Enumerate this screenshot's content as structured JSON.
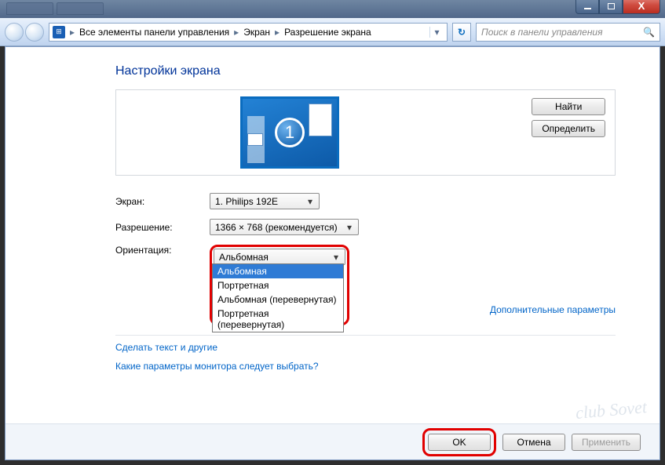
{
  "window": {
    "minimize": "_",
    "maximize": "□",
    "close": "X"
  },
  "toolbar": {
    "breadcrumb": {
      "root": "Все элементы панели управления",
      "lvl1": "Экран",
      "lvl2": "Разрешение экрана"
    },
    "search_placeholder": "Поиск в панели управления",
    "refresh_glyph": "↻"
  },
  "page": {
    "title": "Настройки экрана",
    "monitor_number": "1",
    "find_btn": "Найти",
    "detect_btn": "Определить",
    "labels": {
      "display": "Экран:",
      "resolution": "Разрешение:",
      "orientation": "Ориентация:"
    },
    "values": {
      "display": "1. Philips 192E",
      "resolution": "1366 × 768 (рекомендуется)",
      "orientation": "Альбомная"
    },
    "orientation_options": [
      "Альбомная",
      "Портретная",
      "Альбомная (перевернутая)",
      "Портретная (перевернутая)"
    ],
    "advanced_link": "Дополнительные параметры",
    "link_text": "Сделать текст и другие",
    "link_monitor": "Какие параметры монитора следует выбрать?"
  },
  "footer": {
    "ok": "OK",
    "cancel": "Отмена",
    "apply": "Применить"
  },
  "watermark": "club Sovet"
}
